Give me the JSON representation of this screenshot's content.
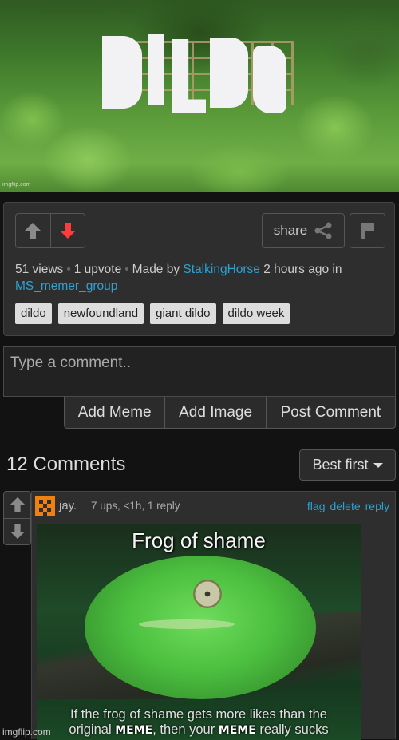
{
  "post": {
    "image": {
      "sign_text": "DILDO",
      "watermark": "imgflip.com"
    },
    "vote": {
      "upvote_label": "upvote",
      "downvote_label": "downvote",
      "state": "downvoted"
    },
    "share_label": "share",
    "flag_label": "flag",
    "meta": {
      "views": "51 views",
      "upvotes": "1 upvote",
      "made_by_prefix": "Made by",
      "author": "StalkingHorse",
      "time": "2 hours ago in",
      "stream": "MS_memer_group",
      "separator": "•"
    },
    "tags": [
      "dildo",
      "newfoundland",
      "giant dildo",
      "dildo week"
    ]
  },
  "comment_form": {
    "placeholder": "Type a comment..",
    "value": "",
    "buttons": [
      "Add Meme",
      "Add Image",
      "Post Comment"
    ]
  },
  "comments_header": {
    "title": "12 Comments",
    "sort_selected": "Best first"
  },
  "comments": [
    {
      "user": "jay.",
      "meta": "7 ups, <1h, 1 reply",
      "actions": [
        "flag",
        "delete",
        "reply"
      ],
      "image": {
        "top_caption": "Frog of shame",
        "bottom_caption_line1": "If the frog of shame gets more likes than the",
        "bottom_caption_line2_a": "original",
        "bottom_caption_line2_b": ", then your",
        "bottom_caption_line2_c": "really sucks",
        "meme_tag": "MEME"
      }
    }
  ],
  "footer_watermark": "imgflip.com",
  "colors": {
    "link": "#2ba3d4",
    "downvote_active": "#ff3b3b",
    "avatar": "#f08010",
    "background": "#121212",
    "panel": "#2e2e2e"
  }
}
